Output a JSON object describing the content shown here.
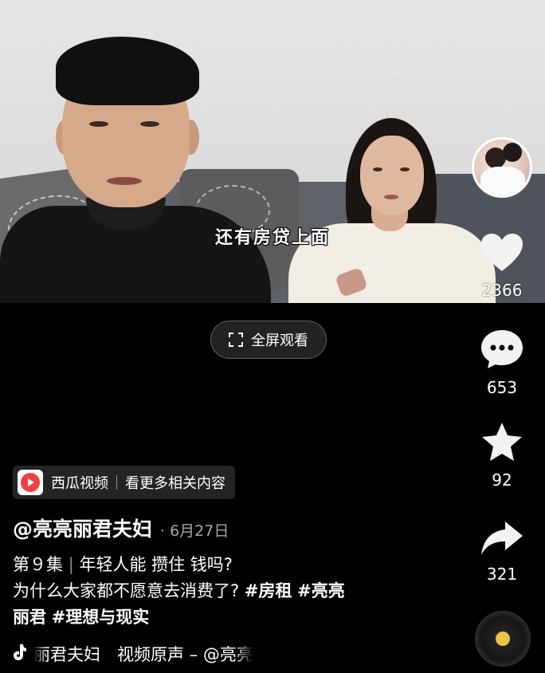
{
  "video": {
    "subtitle": "还有房贷上面"
  },
  "fullscreen": {
    "label": "全屏观看",
    "icon": "fullscreen-icon"
  },
  "sidebar": {
    "avatar_icon": "avatar",
    "like": {
      "icon": "heart-icon",
      "count": "2366"
    },
    "comment": {
      "icon": "comment-icon",
      "count": "653"
    },
    "favorite": {
      "icon": "star-icon",
      "count": "92"
    },
    "share": {
      "icon": "share-arrow-icon",
      "count": "321"
    },
    "music_disc_icon": "music-disc-icon"
  },
  "xigua": {
    "logo_icon": "xigua-logo-icon",
    "app_name": "西瓜视频",
    "link_text": "看更多相关内容"
  },
  "post": {
    "author": "@亮亮丽君夫妇",
    "date": "· 6月27日",
    "episode": "第９集",
    "title_part1": "年轻人能 攒住 钱吗?",
    "title_line2": "为什么大家都不愿意去消费了?",
    "tag1": "#房租",
    "tag2_part1": "#亮亮",
    "tag2_part2": "丽君",
    "tag3": "#理想与现实"
  },
  "music": {
    "icon": "tiktok-note-icon",
    "text": "丽君夫妇　视频原声 – @亮亮"
  },
  "colors": {
    "background": "#000000",
    "text": "#ffffff",
    "xigua_red": "#f04142",
    "disc_center": "#e8c547"
  }
}
